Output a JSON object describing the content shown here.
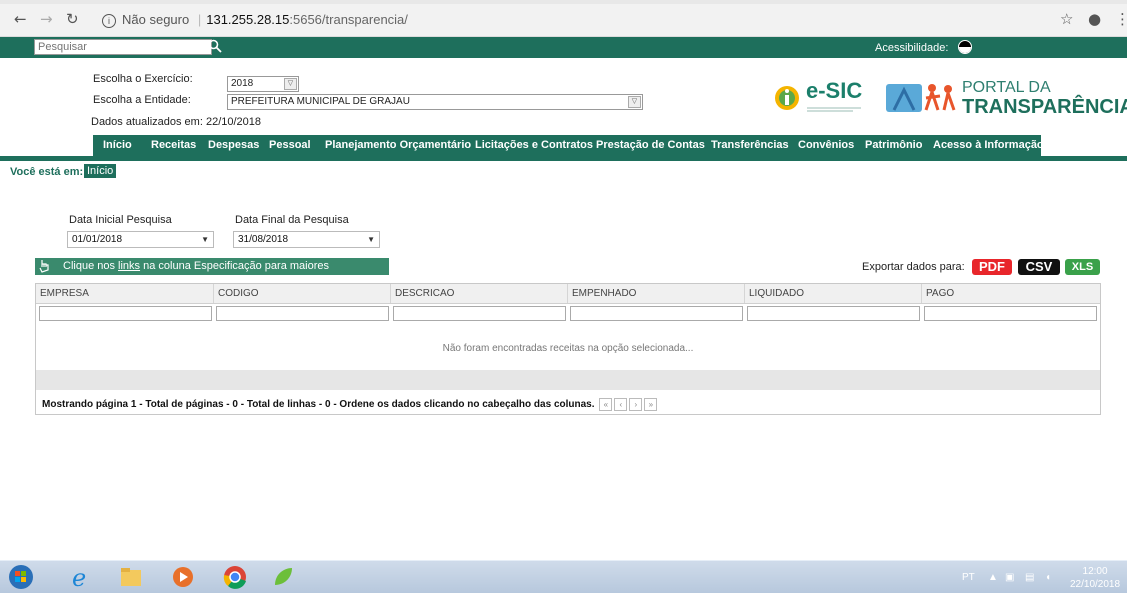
{
  "browser": {
    "security_label": "Não seguro",
    "host": "131.255.28.15",
    "path": ":5656/transparencia/"
  },
  "topbar": {
    "search_placeholder": "Pesquisar",
    "accessibility_label": "Acessibilidade:"
  },
  "header": {
    "exercicio_label": "Escolha o Exercício:",
    "exercicio_value": "2018",
    "entidade_label": "Escolha a Entidade:",
    "entidade_value": "PREFEITURA MUNICIPAL DE GRAJAU",
    "atualizados": "Dados atualizados em: 22/10/2018",
    "esic_logo": "e-SIC",
    "portal_line1": "PORTAL DA",
    "portal_line2": "TRANSPARÊNCIA"
  },
  "menu": {
    "items": [
      "Início",
      "Receitas",
      "Despesas",
      "Pessoal",
      "Planejamento Orçamentário",
      "Licitações e Contratos",
      "Prestação de Contas",
      "Transferências",
      "Convênios",
      "Patrimônio",
      "Acesso à Informação"
    ]
  },
  "breadcrumb": {
    "label": "Você está em:",
    "current": "Início"
  },
  "filters": {
    "data_inicial_label": "Data Inicial Pesquisa",
    "data_inicial_value": "01/01/2018",
    "data_final_label": "Data Final da Pesquisa",
    "data_final_value": "31/08/2018"
  },
  "info": {
    "prefix": "Clique nos ",
    "link": "links",
    "suffix": " na coluna Especificação para maiores informações."
  },
  "export": {
    "label": "Exportar dados para:",
    "pdf": "PDF",
    "csv": "CSV",
    "xls": "XLS",
    "pdf_color": "#e8262b",
    "csv_color": "#111111",
    "xls_color": "#3aa14a"
  },
  "table": {
    "columns": [
      "EMPRESA",
      "CODIGO",
      "DESCRICAO",
      "EMPENHADO",
      "LIQUIDADO",
      "PAGO"
    ],
    "empty_message": "Não foram encontradas receitas na opção selecionada...",
    "pager_text": "Mostrando página 1 - Total de páginas - 0 - Total de linhas - 0 - Ordene os dados clicando no cabeçalho das colunas."
  },
  "taskbar": {
    "lang": "PT",
    "time": "12:00",
    "date": "22/10/2018"
  }
}
